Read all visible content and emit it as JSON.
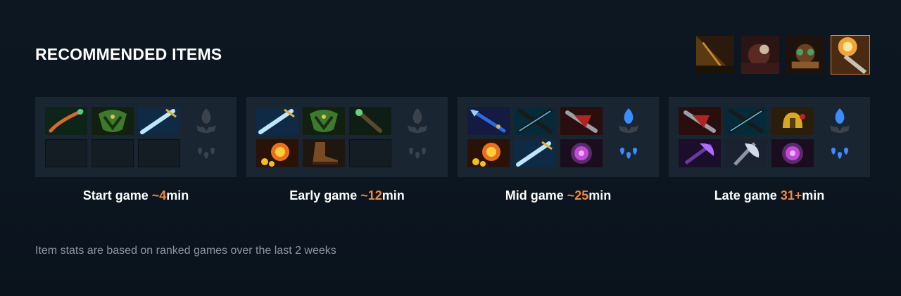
{
  "section": {
    "title": "RECOMMENDED ITEMS"
  },
  "variants": [
    {
      "name": "variant-1-thumbnail",
      "selected": false
    },
    {
      "name": "variant-2-thumbnail",
      "selected": false
    },
    {
      "name": "variant-3-thumbnail",
      "selected": false
    },
    {
      "name": "variant-4-thumbnail",
      "selected": true
    }
  ],
  "stages": [
    {
      "label_prefix": "Start game ",
      "time": "~4",
      "label_suffix": "min",
      "items": [
        "blight-stone-icon",
        "wraith-band-icon",
        "broadsword-icon",
        "empty",
        "empty",
        "empty"
      ],
      "neutral_active": false
    },
    {
      "label_prefix": "Early game ",
      "time": "~12",
      "label_suffix": "min",
      "items": [
        "broadsword-icon",
        "wraith-band-icon",
        "magic-wand-icon",
        "orb-of-fire-icon",
        "boots-icon",
        "empty"
      ],
      "neutral_active": false
    },
    {
      "label_prefix": "Mid game ",
      "time": "~25",
      "label_suffix": "min",
      "items": [
        "dragon-lance-icon",
        "shadow-blade-icon",
        "desolator-icon",
        "orb-of-fire-icon",
        "broadsword-icon",
        "mana-orb-icon"
      ],
      "neutral_active": true
    },
    {
      "label_prefix": "Late game ",
      "time": "31+",
      "label_suffix": "min",
      "items": [
        "desolator-icon",
        "shadow-blade-icon",
        "helm-icon",
        "crystal-axe-icon",
        "silver-axe-icon",
        "mana-orb-icon"
      ],
      "neutral_active": true
    }
  ],
  "footnote": "Item stats are based on ranked games over the last 2 weeks",
  "colors": {
    "accent": "#f2893c",
    "panel": "#1a2532",
    "background": "#0c1620",
    "neutral_active": "#3b8cff"
  }
}
